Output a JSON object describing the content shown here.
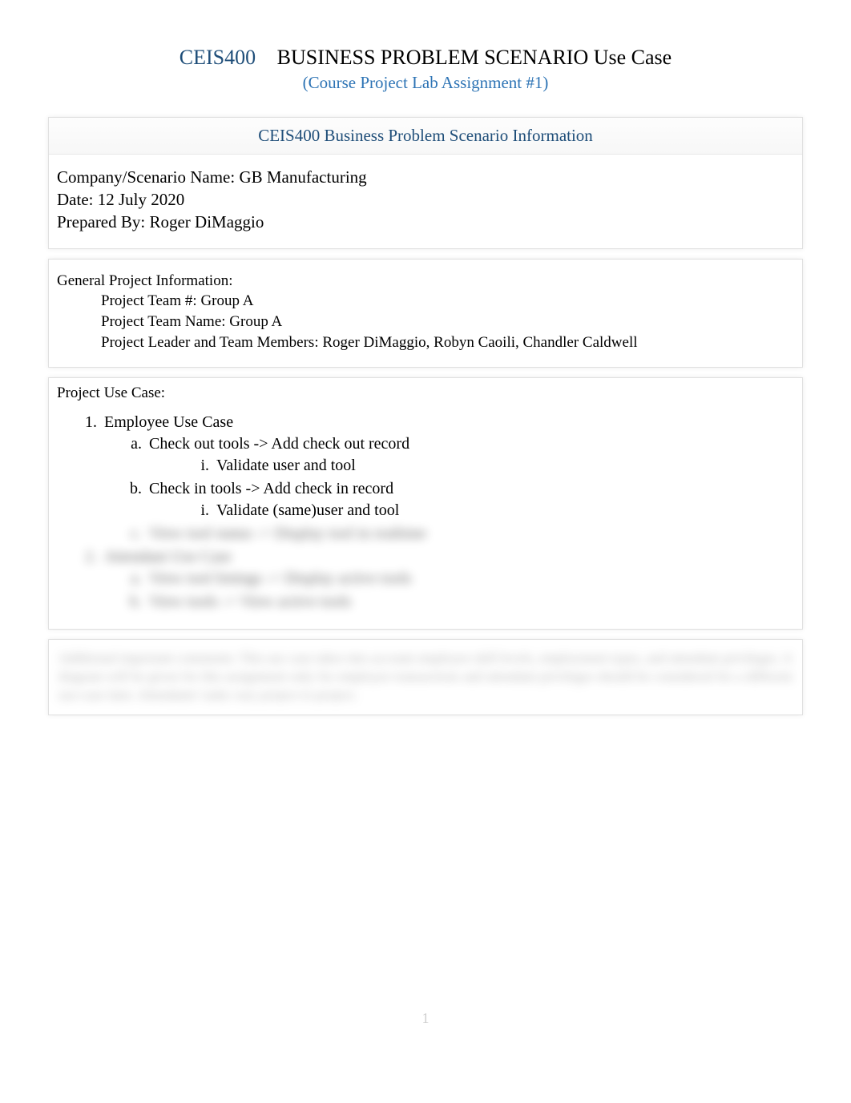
{
  "header": {
    "course_code": "CEIS400",
    "title": "BUSINESS PROBLEM SCENARIO Use Case",
    "subtitle": "(Course Project Lab Assignment #1)"
  },
  "info_box": {
    "heading": "CEIS400 Business Problem Scenario Information",
    "company_label": "Company/Scenario Name:",
    "company_value": "GB Manufacturing",
    "date_label": "Date:",
    "date_value": "12 July 2020",
    "prepared_label": "Prepared By:",
    "prepared_value": "Roger DiMaggio"
  },
  "gpi": {
    "heading": "General Project Information:",
    "team_num_label": "Project Team #:",
    "team_num_value": "Group A",
    "team_name_label": "Project Team Name:",
    "team_name_value": "Group A",
    "leader_label": "Project Leader and Team Members:",
    "leader_value": "Roger DiMaggio, Robyn Caoili, Chandler Caldwell"
  },
  "usecase": {
    "heading": "Project Use Case:",
    "item1": {
      "title": "Employee Use Case",
      "a": "Check out tools -> Add check out record",
      "a_i": "Validate user and tool",
      "b": "Check in tools -> Add check in record",
      "b_i": "Validate (same)user and tool",
      "c_blurred": "View tool status -> Display tool in realtime"
    },
    "item2_blurred": {
      "title": "Attendant Use Case",
      "a": "View tool listings -> Display active tools",
      "b": "View tools -> View active tools"
    }
  },
  "footer_blurred": "Additional important comments: This use case takes into account employee skill levels, employment types, and attendant privileges. A diagram will be given for this assignment only for employee transactions and attendant privileges should be considered for a different use-case later. Attendants' tasks vary project to project.",
  "page_number": "1"
}
